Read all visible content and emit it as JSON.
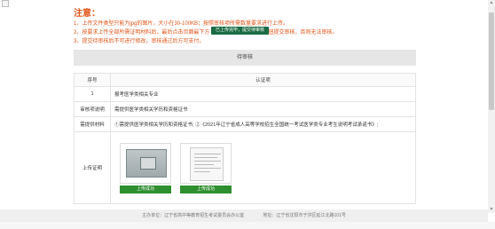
{
  "notice": {
    "title": "注意：",
    "lines": [
      "1、上传文件类型只能为jpg的图片，大小在30-100KB；按照审核项所需数量要求进行上传。",
      "2、按要求上传全部所需证明材料后，最后点击页面最下方",
      "3、提交待审核后不可进行修改，审核通过后方可支付。"
    ],
    "line2_tail": "按钮提交审核，否则无法审核。",
    "tooltip": "已上传完毕，提交待审核"
  },
  "panel": {
    "header": "待审核",
    "table": {
      "col1_header": "序号",
      "col2_header": "认证项",
      "rows": [
        {
          "label": "1",
          "value": "报考医学类相关专业"
        },
        {
          "label": "审核项说明",
          "value": "需提供医学类相关学历和资格证书"
        },
        {
          "label": "需提供材料",
          "value": "①需提供医学类相关学历和资格证书; ②《2021年辽宁省成人高等学校招生全国统一考试医学类专业考生说明考试承诺书》;"
        }
      ],
      "upload_label": "上传证明",
      "uploads": [
        {
          "button": "上传成功"
        },
        {
          "button": "上传成功"
        }
      ]
    }
  },
  "footer": {
    "sponsor": "主办单位：辽宁省高中等教育招生考试委员会办公室",
    "address": "地址：辽宁省沈阳市于洪区延江北路101号"
  }
}
